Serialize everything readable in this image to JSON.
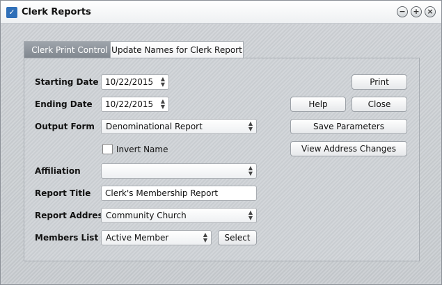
{
  "window": {
    "title": "Clerk Reports"
  },
  "tabs": [
    {
      "label": "Clerk Print Control",
      "active": true
    },
    {
      "label": "Update Names for Clerk Report",
      "active": false
    }
  ],
  "form": {
    "starting_date": {
      "label": "Starting Date",
      "value": "10/22/2015"
    },
    "ending_date": {
      "label": "Ending Date",
      "value": "10/22/2015"
    },
    "output_form": {
      "label": "Output Form",
      "value": "Denominational Report"
    },
    "invert_name": {
      "label": "Invert Name",
      "checked": false
    },
    "affiliation": {
      "label": "Affiliation",
      "value": ""
    },
    "report_title": {
      "label": "Report Title",
      "value": "Clerk's Membership Report"
    },
    "report_address": {
      "label": "Report Address",
      "value": "Community Church"
    },
    "members_list": {
      "label": "Members List",
      "value": "Active Member"
    }
  },
  "buttons": {
    "print": "Print",
    "help": "Help",
    "close": "Close",
    "save_parameters": "Save Parameters",
    "view_address_changes": "View Address Changes",
    "select": "Select"
  },
  "icons": {
    "spin": "▲▼",
    "dropdown": "▲▼",
    "minimize": "−",
    "maximize": "+",
    "close": "×"
  }
}
